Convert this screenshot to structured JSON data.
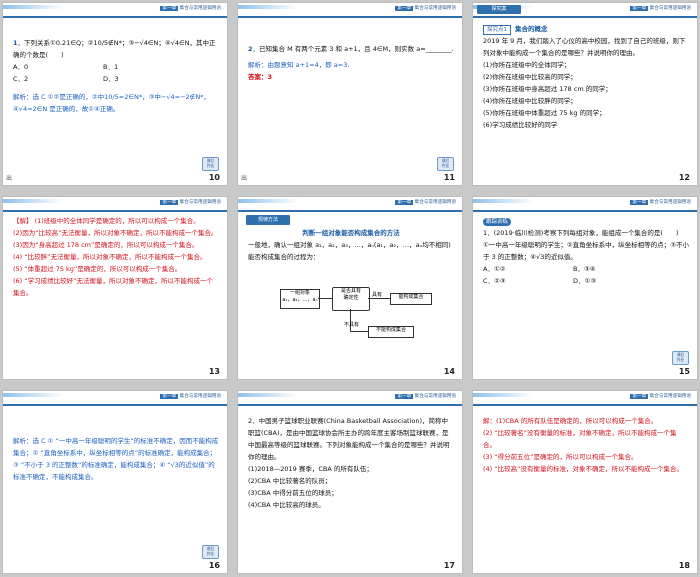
{
  "header": {
    "chapter_label": "第一章",
    "chapter_title": "集合与常用逻辑用语",
    "section_badge": "探究案"
  },
  "back_button": {
    "label": "课后\n作业"
  },
  "slides": {
    "s10": {
      "number": "10",
      "caption": "出",
      "q_lead": "下列关系①0.21∈Q；②",
      "q_frac": "10/5",
      "q_rest": "∉N*；③−√4∈N；④√4∈N，其中正确的个数是(　　)",
      "options": [
        "A．0",
        "B．1",
        "C．2",
        "D．3"
      ],
      "solution": "解析：选 C ①②是正确的，②中10/5=2∈N*，③中−√4=−2∉N*，④√4=2∈N 是正确的，故①④正确。"
    },
    "s11": {
      "number": "11",
      "caption": "出",
      "q": "已知集合 M 有两个元素 3 和 a+1，且 4∈M，则实数 a=________.",
      "solution": "解析：由题意知 a+1=4，即 a=3.",
      "answer": "答案：3"
    },
    "s12": {
      "number": "12",
      "tag": "探究点1",
      "tag_title": "集合的概念",
      "intro": "2019 年 9 月，我们踏入了心仪的高中校园，找到了自己的班级，则下列对象中能构成一个集合的是哪些？并说明你的理由。",
      "items": [
        "(1)你所在班级中的全体同学；",
        "(2)你所在班级中比较高的同学；",
        "(3)你所在班级中身高超过 178 cm 的同学；",
        "(4)你所在班级中比较胖的同学；",
        "(5)你所在班级中体重超过 75 kg 的同学；",
        "(6)学习成绩比较好的同学"
      ]
    },
    "s13": {
      "number": "13",
      "lines": [
        "【解】 (1)班级中的全体同学是确定的，所以可以构成一个集合。",
        "(2)因为“比较高”无法衡量，所以对象不确定，所以不能构成一个集合。",
        "(3)因为“身高超过 178 cm”是确定的，所以可以构成一个集合。",
        "(4) “比较胖”无法衡量，所以对象不确定，所以不能构成一个集合。",
        "(5) “体重超过 75 kg”是确定的，所以可以构成一个集合。",
        "(6) “学习成绩比较好”无法衡量，所以对象不确定，所以不能构成一个集合。"
      ]
    },
    "s14": {
      "number": "14",
      "badge": "规律方法",
      "title": "判断一组对象能否构成集合的方法",
      "body": "一般地，确认一组对象 a₁，a₂，a₃，…，aₙ(a₁，a₂，…，aₙ均不相同)能否构成集合的过程为：",
      "flow": {
        "start": "一组对象\na₁，a₂，…，aₙ",
        "decision": "是否具有\n确定性",
        "yes": "具有",
        "yes_result": "能构成集合",
        "no": "不具有",
        "no_result": "不能构成集合"
      }
    },
    "s15": {
      "number": "15",
      "badge": "跟踪训练",
      "q": "1．(2019·临川检测)考察下列每组对象，能组成一个集合的是(　　)",
      "items": [
        "①一中高一年级聪明的学生；②直角坐标系中，纵坐标相等的点；③不小于 3 的正整数；④√3的近似值。"
      ],
      "options": [
        "A．①②",
        "B．③④",
        "C．②③",
        "D．①③"
      ]
    },
    "s16": {
      "number": "16",
      "solution": "解析：选 C ① “一中高一年级聪明的学生”的标准不确定，因而不能构成集合；② “直角坐标系中，纵坐标相等的点”的标准确定，能构成集合；③ “不小于 3 的正整数”的标准确定，能构成集合；④ “√3的近似值”的标准不确定，不能构成集合。"
    },
    "s17": {
      "number": "17",
      "q": "2．中国男子篮球职业联赛(China Basketball Association)，简称中职篮(CBA)，是由中国篮球协会所主办的跨年度主客场制篮球联赛，是中国最高等级的篮球联赛。下列对象能构成一个集合的是哪些？并说明你的理由。",
      "items": [
        "(1)2018—2019 赛季，CBA 的所有队伍；",
        "(2)CBA 中比较著名的队员；",
        "(3)CBA 中得分前五位的球员；",
        "(4)CBA 中比较高的球员。"
      ]
    },
    "s18": {
      "number": "18",
      "lines": [
        "解：(1)CBA 的所有队伍是确定的，所以可以构成一个集合。",
        "(2) “比较著名”没有衡量的标准，对象不确定，所以不能构成一个集合。",
        "(3) “得分前五位”是确定的，所以可以构成一个集合。",
        "(4) “比较高”没有衡量的标准，对象不确定，所以不能构成一个集合。"
      ]
    }
  }
}
